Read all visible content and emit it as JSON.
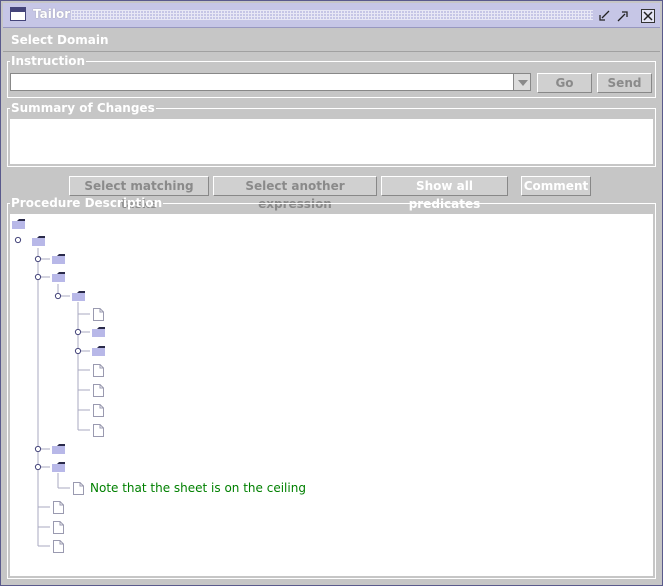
{
  "window": {
    "title": "Tailor"
  },
  "menu": {
    "select_domain": "Select Domain"
  },
  "instruction": {
    "legend": "Instruction",
    "value": "",
    "go_label": "Go",
    "send_label": "Send"
  },
  "summary": {
    "legend": "Summary of Changes"
  },
  "actions": {
    "select_matching": "Select matching tasks",
    "select_another": "Select another expression",
    "show_predicates": "Show all predicates",
    "comment": "Comment"
  },
  "procedure": {
    "legend": "Procedure Description",
    "note": "Note that the sheet is on the ceiling"
  },
  "colors": {
    "title_bg": "#c6c6e6",
    "panel": "#c6c6c6",
    "note_text": "#008000",
    "folder": "#b8b8e8"
  },
  "icons": [
    "app-window-icon",
    "minimize-icon",
    "maximize-icon",
    "close-icon",
    "folder-icon",
    "document-icon",
    "tree-handle-icon",
    "dropdown-arrow-icon"
  ]
}
